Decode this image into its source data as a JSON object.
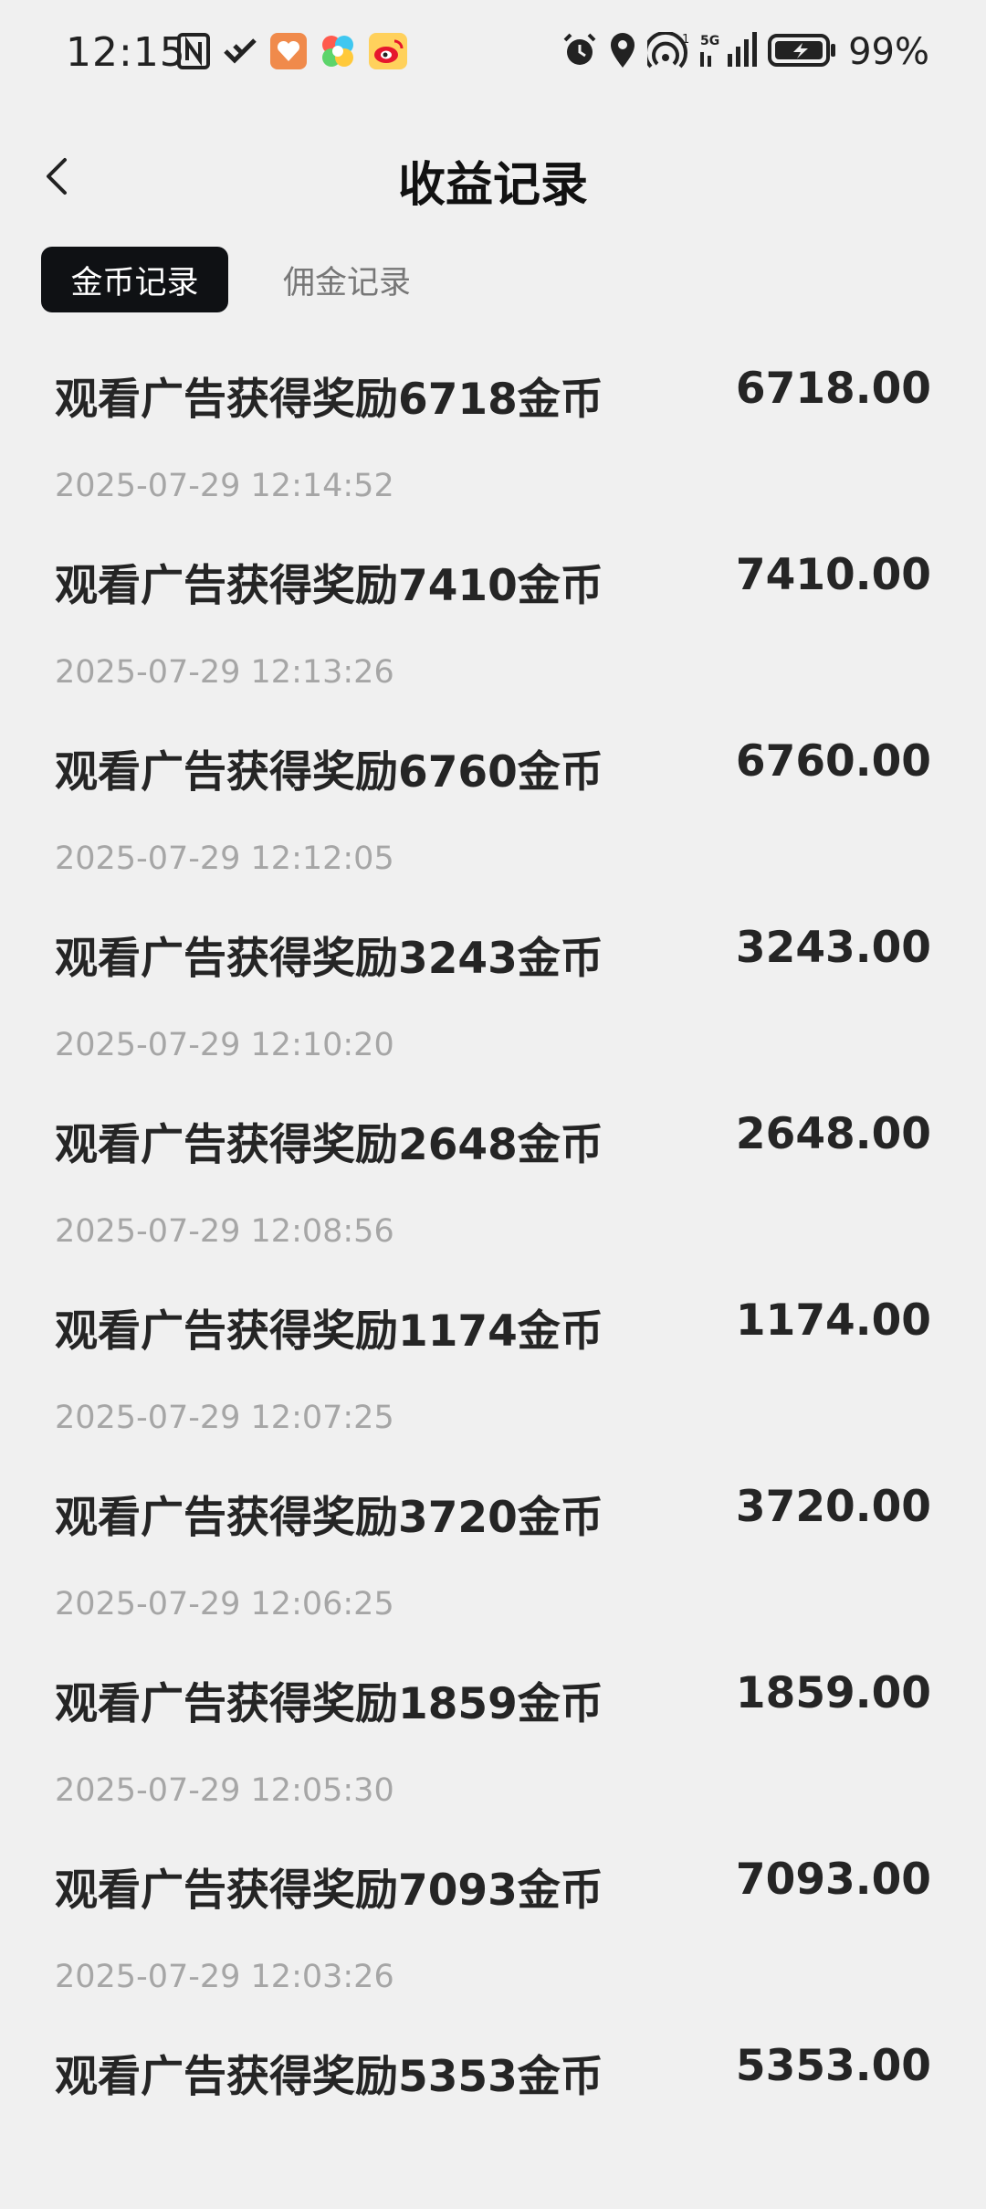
{
  "status_bar": {
    "time": "12:15",
    "battery": "99%",
    "signal_label": "5G"
  },
  "header": {
    "title": "收益记录"
  },
  "tabs": [
    {
      "label": "金币记录",
      "active": true
    },
    {
      "label": "佣金记录",
      "active": false
    }
  ],
  "records": [
    {
      "title": "观看广告获得奖励6718金币",
      "amount": "6718.00",
      "time": "2025-07-29 12:14:52"
    },
    {
      "title": "观看广告获得奖励7410金币",
      "amount": "7410.00",
      "time": "2025-07-29 12:13:26"
    },
    {
      "title": "观看广告获得奖励6760金币",
      "amount": "6760.00",
      "time": "2025-07-29 12:12:05"
    },
    {
      "title": "观看广告获得奖励3243金币",
      "amount": "3243.00",
      "time": "2025-07-29 12:10:20"
    },
    {
      "title": "观看广告获得奖励2648金币",
      "amount": "2648.00",
      "time": "2025-07-29 12:08:56"
    },
    {
      "title": "观看广告获得奖励1174金币",
      "amount": "1174.00",
      "time": "2025-07-29 12:07:25"
    },
    {
      "title": "观看广告获得奖励3720金币",
      "amount": "3720.00",
      "time": "2025-07-29 12:06:25"
    },
    {
      "title": "观看广告获得奖励1859金币",
      "amount": "1859.00",
      "time": "2025-07-29 12:05:30"
    },
    {
      "title": "观看广告获得奖励7093金币",
      "amount": "7093.00",
      "time": "2025-07-29 12:03:26"
    },
    {
      "title": "观看广告获得奖励5353金币",
      "amount": "5353.00",
      "time": ""
    }
  ],
  "icons": {
    "back": "chevron-left-icon",
    "nfc": "nfc-icon",
    "app1": "check-app-icon",
    "app2": "heart-app-icon",
    "app3": "colorful-app-icon",
    "app4": "weibo-icon",
    "alarm": "alarm-icon",
    "location": "location-icon",
    "hotspot": "hotspot-icon",
    "signal": "signal-icon",
    "battery": "battery-icon"
  },
  "colors": {
    "background": "#f0f0f0",
    "tab_active_bg": "#0f1114",
    "tab_active_text": "#ffffff",
    "tab_inactive_text": "#777777",
    "title_text": "#252525",
    "time_text": "#a6a6a6"
  }
}
